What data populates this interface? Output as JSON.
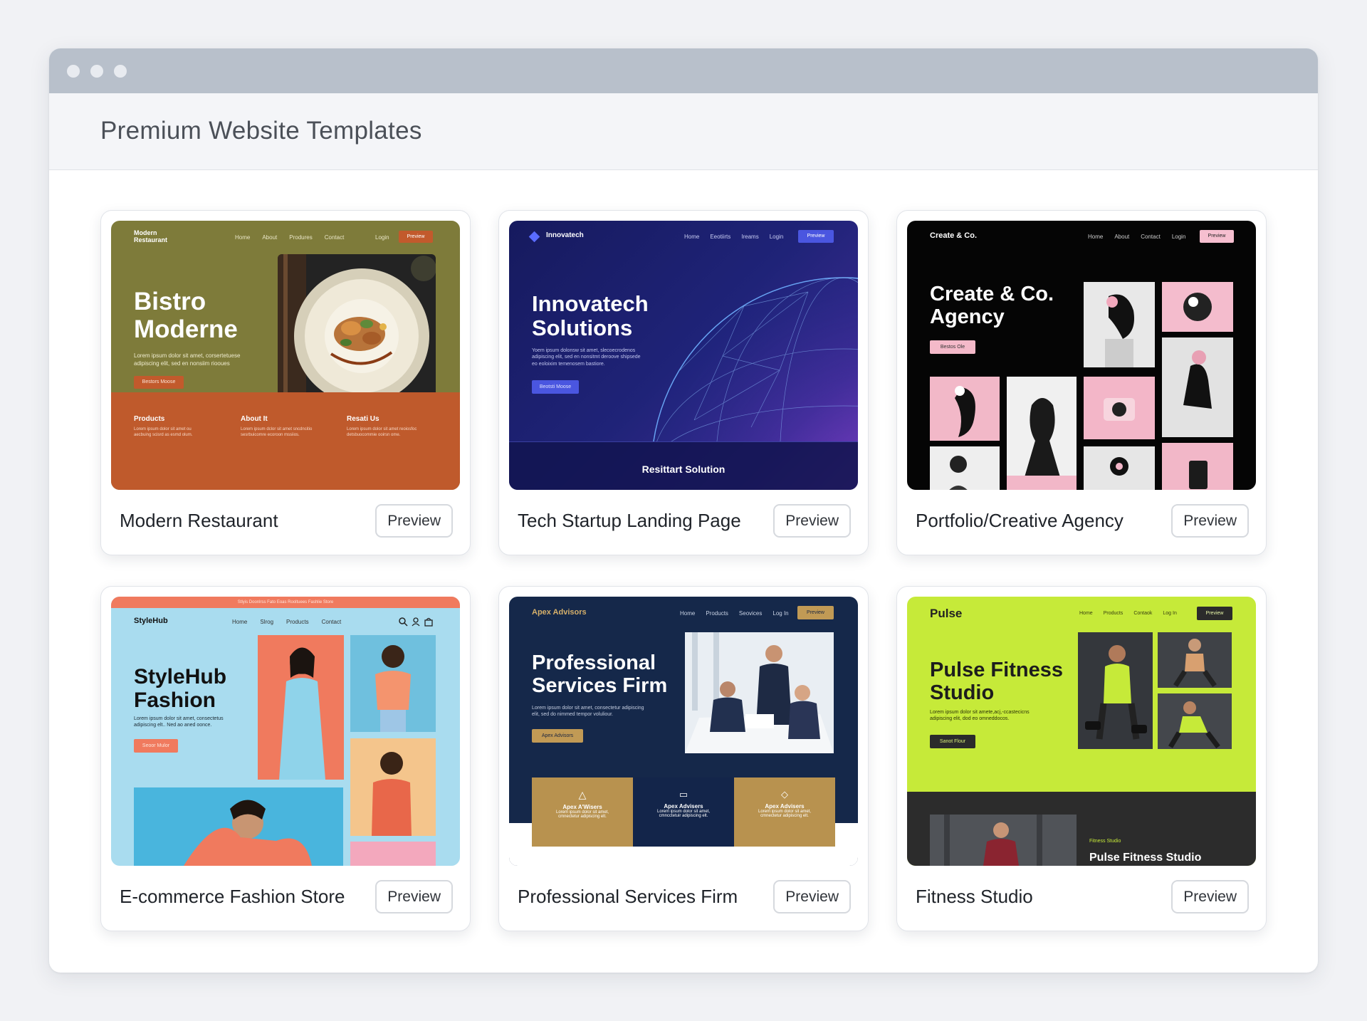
{
  "page": {
    "title": "Premium Website Templates"
  },
  "cards": [
    {
      "title": "Modern Restaurant",
      "preview": "Preview",
      "thumb": {
        "brand_line1": "Modern",
        "brand_line2": "Restaurant",
        "nav": [
          "Home",
          "About",
          "Produres",
          "Contact",
          "Login"
        ],
        "cta": "Preview",
        "hero_line1": "Bistro",
        "hero_line2": "Moderne",
        "lorem_line1": "Lorem ipsum dolor sit amet, corsertetuese",
        "lorem_line2": "adipiscing elit, sed en nonsiim riooues",
        "button": "Bestors Moose",
        "footer_cols": [
          {
            "heading": "Products",
            "line1": "Lorem ipsum dolor sit amet ou",
            "line2": "aecbuing scisrd as esmd olum."
          },
          {
            "heading": "About It",
            "line1": "Lorem ipsum dclor sit amet sncdncitio",
            "line2": "sesrbuicomre ecoroon mssiios."
          },
          {
            "heading": "Resati Us",
            "line1": "Lorem ipsum dolor sit amet reoiosfoc",
            "line2": "detsbuocommie ooirsn ome."
          }
        ]
      }
    },
    {
      "title": "Tech Startup Landing Page",
      "preview": "Preview",
      "thumb": {
        "brand": "Innovatech",
        "nav": [
          "Home",
          "Eeotiirts",
          "Ireams",
          "Login"
        ],
        "cta": "Preview",
        "hero_line1": "Innovatech",
        "hero_line2": "Solutions",
        "lorem_line1": "Yoem ipsum dolonsw sit amet, slecoecrodenos",
        "lorem_line2": "adipiscing elit, sed en nonsitmt deroove shipsede",
        "lorem_line3": "eo eoloixim temenosem bastiore.",
        "button": "Beotsti Moose",
        "footer": "Resittart Solution"
      }
    },
    {
      "title": "Portfolio/Creative Agency",
      "preview": "Preview",
      "thumb": {
        "brand": "Create & Co.",
        "nav": [
          "Home",
          "About",
          "Contact",
          "Login"
        ],
        "cta": "Preview",
        "hero_line1": "Create & Co.",
        "hero_line2": "Agency",
        "button": "Bestos Ole"
      }
    },
    {
      "title": "E-commerce Fashion Store",
      "preview": "Preview",
      "thumb": {
        "banner": "Stlyis Doonlrss Fato Eoas Rooltuees Fashlie Store",
        "brand": "StyleHub",
        "nav": [
          "Home",
          "Slrog",
          "Products",
          "Contact"
        ],
        "hero_line1": "StyleHub",
        "hero_line2": "Fashion",
        "lorem_line1": "Lorem ipsum dolor sit amet, consectetus",
        "lorem_line2": "adipiscing elt.. Ned ao aned oonce.",
        "button": "Seoor Mulor"
      }
    },
    {
      "title": "Professional Services Firm",
      "preview": "Preview",
      "thumb": {
        "brand": "Apex Advisors",
        "nav": [
          "Home",
          "Products",
          "Seovices",
          "Log In"
        ],
        "cta": "Preview",
        "hero_line1": "Professional",
        "hero_line2": "Services Firm",
        "lorem_line1": "Lorem ipsum dolor sit amet, consectetur adipiscing",
        "lorem_line2": "elit, sed do nimmed tempor voluliour.",
        "button": "Apex Advisors",
        "tiles": [
          {
            "title": "Apex A'Wisers",
            "line1": "Lorem ipsum dolor sit amet,",
            "line2": "cmnectetur adipiscing elt."
          },
          {
            "title": "Apex Advisers",
            "line1": "Lorem ipsum dolor sit amet,",
            "line2": "cmncctetuir adipiscing elt."
          },
          {
            "title": "Apex Advisers",
            "line1": "Lorem ipsum dolor sit amet,",
            "line2": "cmnectetur adipiscing elt."
          }
        ]
      }
    },
    {
      "title": "Fitness Studio",
      "preview": "Preview",
      "thumb": {
        "brand": "Pulse",
        "nav": [
          "Home",
          "Products",
          "Contaok",
          "Log In"
        ],
        "cta": "Preview",
        "hero_line1": "Pulse Fitness",
        "hero_line2": "Studio",
        "lorem_line1": "Lorem ipsum dolor sit amete,acj,-ccastecicns",
        "lorem_line2": "adipiscing elit, dod eo omneddocos.",
        "button": "Sanot Flour",
        "bottom_label": "Fitness Studio",
        "bottom_title": "Pulse Fitness Studio"
      }
    }
  ],
  "colors": {
    "restaurant_olive": "#7e7b3a",
    "restaurant_orange": "#bf5a2c",
    "tech_navy": "#1c1f6b",
    "tech_accent": "#4a56e0",
    "agency_black": "#050505",
    "agency_pink": "#f4c0cf",
    "fashion_sky": "#a9dcef",
    "fashion_coral": "#f07a5e",
    "advisors_navy": "#15284a",
    "advisors_gold": "#b8924f",
    "fitness_lime": "#c6ea39",
    "fitness_dark": "#2c2c2c"
  }
}
